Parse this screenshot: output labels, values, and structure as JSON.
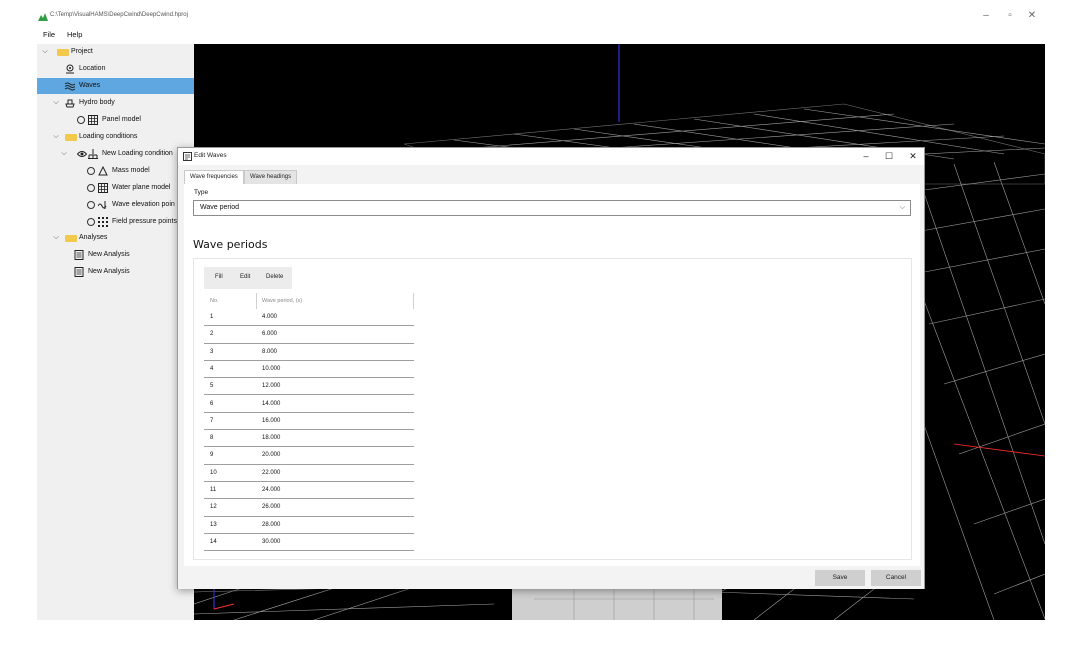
{
  "window": {
    "title": "C:\\Temp\\VisualHAMS\\DeepCwind\\DeepCwind.hproj",
    "min_glyph": "–",
    "max_glyph": "▫",
    "close_glyph": "✕"
  },
  "menu": {
    "file": "File",
    "help": "Help"
  },
  "tree": {
    "project": "Project",
    "location": "Location",
    "waves": "Waves",
    "hydro_body": "Hydro body",
    "panel_model": "Panel model",
    "loading_conditions": "Loading conditions",
    "new_loading_condition": "New Loading condition",
    "mass_model": "Mass model",
    "water_plane_model": "Water plane model",
    "wave_elevation_points": "Wave elevation poin",
    "field_pressure_points": "Field pressure points",
    "analyses": "Analyses",
    "new_analysis_1": "New Analysis",
    "new_analysis_2": "New Analysis"
  },
  "dialog": {
    "title": "Edit Waves",
    "min_glyph": "–",
    "max_glyph": "☐",
    "close_glyph": "✕",
    "tabs": {
      "frequencies": "Wave frequencies",
      "headings": "Wave headings"
    },
    "type_label": "Type",
    "type_value": "Wave period",
    "section_title": "Wave periods",
    "toolbar": {
      "fill": "Fill",
      "edit": "Edit",
      "delete": "Delete"
    },
    "columns": {
      "no": "No.",
      "period": "Wave period, (s)"
    },
    "rows": [
      {
        "no": "1",
        "period": "4.000"
      },
      {
        "no": "2",
        "period": "6.000"
      },
      {
        "no": "3",
        "period": "8.000"
      },
      {
        "no": "4",
        "period": "10.000"
      },
      {
        "no": "5",
        "period": "12.000"
      },
      {
        "no": "6",
        "period": "14.000"
      },
      {
        "no": "7",
        "period": "16.000"
      },
      {
        "no": "8",
        "period": "18.000"
      },
      {
        "no": "9",
        "period": "20.000"
      },
      {
        "no": "10",
        "period": "22.000"
      },
      {
        "no": "11",
        "period": "24.000"
      },
      {
        "no": "12",
        "period": "26.000"
      },
      {
        "no": "13",
        "period": "28.000"
      },
      {
        "no": "14",
        "period": "30.000"
      }
    ],
    "save_label": "Save",
    "cancel_label": "Cancel"
  },
  "colors": {
    "selection": "#5ea7e0",
    "viewport_bg": "#000000",
    "grid_line": "#ffffff",
    "axis_blue": "#3a3aff",
    "axis_red": "#ff3030",
    "folder": "#f2c94c"
  }
}
